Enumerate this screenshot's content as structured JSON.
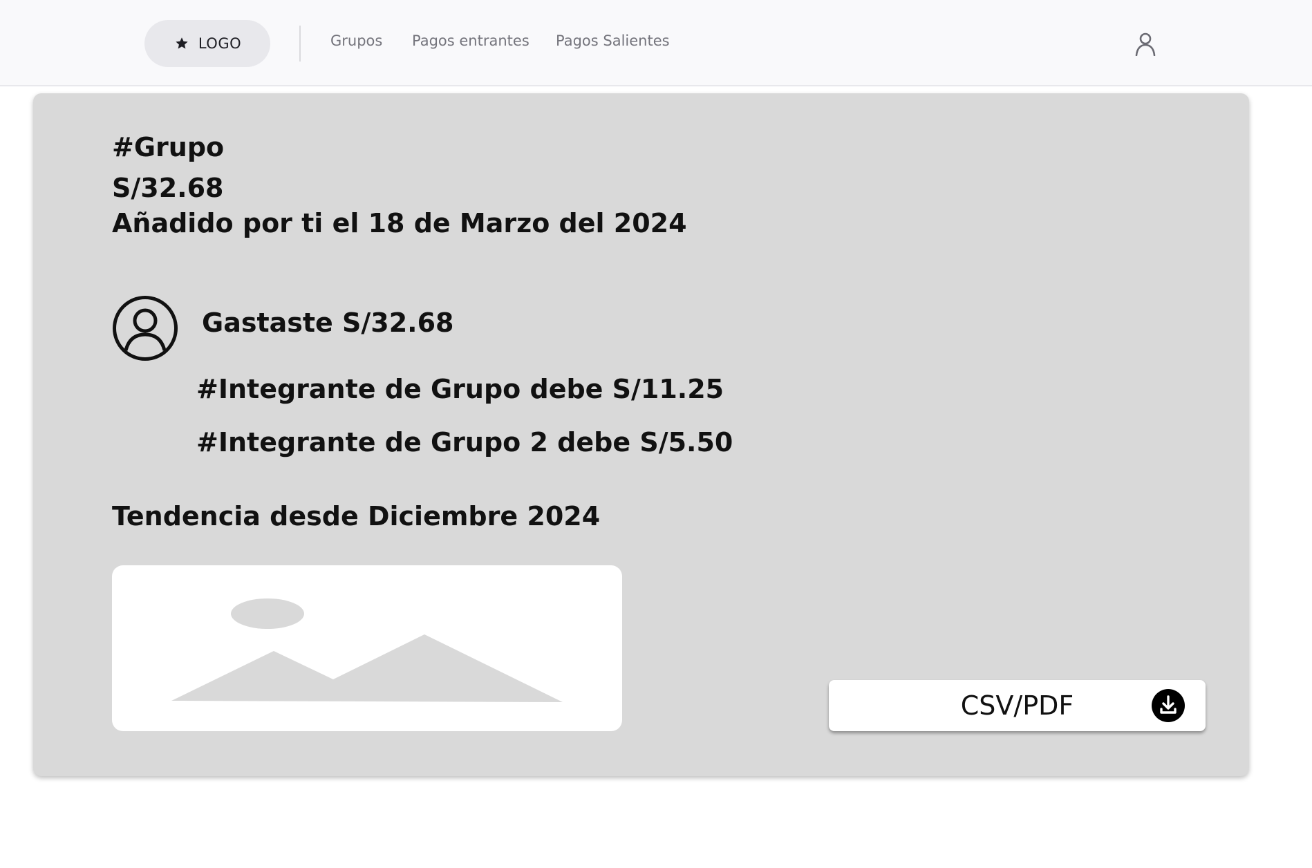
{
  "navbar": {
    "logo_label": "LOGO",
    "links": [
      "Grupos",
      "Pagos entrantes",
      "Pagos Salientes"
    ]
  },
  "card": {
    "group_title": "#Grupo",
    "amount": "S/32.68",
    "added_text": "Añadido  por ti el 18 de Marzo del 2024",
    "spent_text": "Gastaste S/32.68",
    "debts": [
      "#Integrante de Grupo debe S/11.25",
      "#Integrante de Grupo 2 debe S/5.50"
    ],
    "trend_title": "Tendencia desde Diciembre 2024",
    "export_label": "CSV/PDF"
  },
  "icons": {
    "logo": "star-icon",
    "user": "user-icon",
    "avatar": "avatar-icon",
    "image_placeholder": "image-placeholder-icon",
    "download": "download-icon"
  },
  "colors": {
    "navbar_bg": "#f9f9fb",
    "card_bg": "#d9d9d9",
    "nav_link": "#74747c",
    "text": "#111111"
  }
}
